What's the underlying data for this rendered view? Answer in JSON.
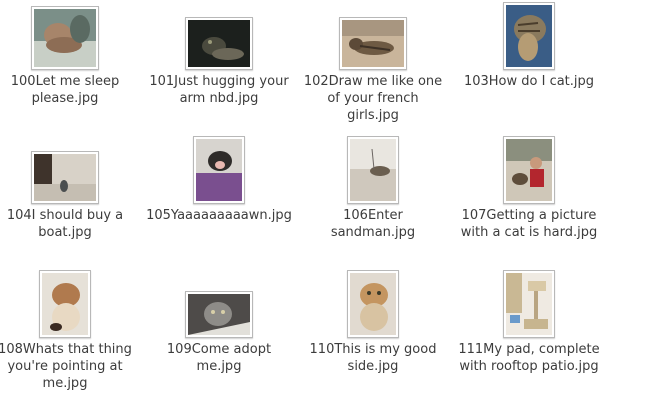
{
  "files": [
    {
      "name": "100Let me sleep please.jpg",
      "icon": "image-thumbnail-sleeping-cat"
    },
    {
      "name": "101Just hugging your arm nbd.jpg",
      "icon": "image-thumbnail-dark-cat"
    },
    {
      "name": "102Draw me like one of your french girls.jpg",
      "icon": "image-thumbnail-lounging-cat"
    },
    {
      "name": "103How do I cat.jpg",
      "icon": "image-thumbnail-tabby-cat"
    },
    {
      "name": "104I should buy a boat.jpg",
      "icon": "image-thumbnail-cat-on-floor"
    },
    {
      "name": "105Yaaaaaaaaawn.jpg",
      "icon": "image-thumbnail-yawning-cat"
    },
    {
      "name": "106Enter sandman.jpg",
      "icon": "image-thumbnail-cat-on-couch"
    },
    {
      "name": "107Getting a picture with a cat is hard.jpg",
      "icon": "image-thumbnail-person-with-cat"
    },
    {
      "name": "108Whats that thing you're pointing at me.jpg",
      "icon": "image-thumbnail-curious-cat"
    },
    {
      "name": "109Come adopt me.jpg",
      "icon": "image-thumbnail-kitten"
    },
    {
      "name": "110This is my good side.jpg",
      "icon": "image-thumbnail-posing-cat"
    },
    {
      "name": "111My pad, complete with rooftop patio.jpg",
      "icon": "image-thumbnail-cat-tower"
    }
  ]
}
